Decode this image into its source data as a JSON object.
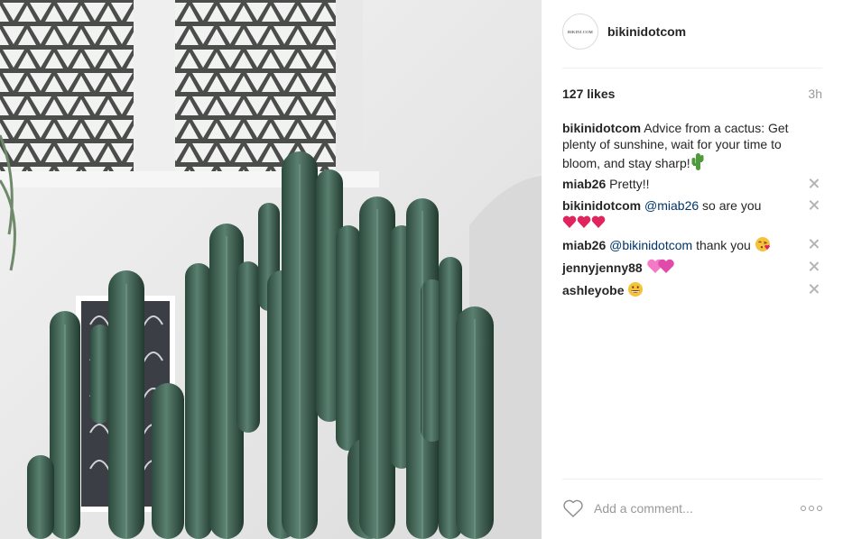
{
  "post": {
    "account": {
      "username": "bikinidotcom",
      "avatar_text": "BIKINI.COM"
    },
    "photo": {
      "subject": "cactus-in-courtyard"
    },
    "likes": "127 likes",
    "age": "3h",
    "caption": {
      "user": "bikinidotcom",
      "text": "Advice from a cactus: Get plenty of sunshine, wait for your time to bloom, and stay sharp!",
      "emoji": "cactus"
    },
    "comments": [
      {
        "user": "miab26",
        "mention": "",
        "text": "Pretty!!",
        "emoji": ""
      },
      {
        "user": "bikinidotcom",
        "mention": "@miab26",
        "text": "so are you",
        "emoji": "three-red-hearts"
      },
      {
        "user": "miab26",
        "mention": "@bikinidotcom",
        "text": "thank you",
        "emoji": "face-blowing-kiss"
      },
      {
        "user": "jennyjenny88",
        "mention": "",
        "text": "",
        "emoji": "two-pink-hearts"
      },
      {
        "user": "ashleyobe",
        "mention": "",
        "text": "",
        "emoji": "grinning-face"
      }
    ],
    "composer": {
      "placeholder": "Add a comment...",
      "like_icon": "heart-outline-icon",
      "more_icon": "more-options-icon"
    }
  },
  "colors": {
    "text": "#262626",
    "muted": "#999999",
    "mention": "#003569",
    "divider": "#efefef",
    "heart_red": "#e0245e",
    "cactus_green": "#3c5e4e"
  }
}
